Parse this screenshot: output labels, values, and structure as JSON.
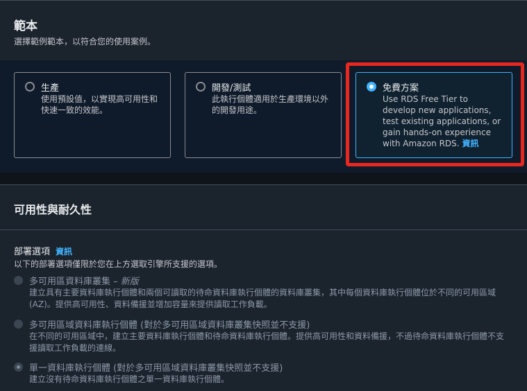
{
  "templates": {
    "title": "範本",
    "description": "選擇範例範本，以符合您的使用案例。",
    "options": [
      {
        "title": "生產",
        "description": "使用預設值，以實現高可用性和快速一致的效能。",
        "selected": false
      },
      {
        "title": "開發/測試",
        "description": "此執行個體適用於生產環境以外的開發用途。",
        "selected": false
      },
      {
        "title": "免費方案",
        "description": "Use RDS Free Tier to develop new applications, test existing applications, or gain hands-on experience with Amazon RDS.",
        "info_link": "資訊",
        "selected": true
      }
    ],
    "highlight_color": "#e8281f",
    "accent_color": "#42b4ff"
  },
  "availability": {
    "title": "可用性與耐久性",
    "deployment_label": "部署選項",
    "deployment_info_link": "資訊",
    "deployment_description": "以下的部署選項僅限於您在上方選取引擎所支援的選項。",
    "options": [
      {
        "title": "多可用區資料庫叢集",
        "title_suffix": "新版",
        "separator": " – ",
        "description": "建立具有主要資料庫執行個體和兩個可讀取的待命資料庫執行個體的資料庫叢集，其中每個資料庫執行個體位於不同的可用區域 (AZ)。提供高可用性、資料備援並增加容量來提供讀取工作負載。",
        "selected": false,
        "disabled": true
      },
      {
        "title": "多可用區域資料庫執行個體 (對於多可用區域資料庫叢集快照並不支援)",
        "description": "在不同的可用區域中，建立主要資料庫執行個體和待命資料庫執行個體。提供高可用性和資料備援，不過待命資料庫執行個體不支援讀取工作負載的連線。",
        "selected": false,
        "disabled": true
      },
      {
        "title": "單一資料庫執行個體 (對於多可用區域資料庫叢集快照並不支援)",
        "description": "建立沒有待命資料庫執行個體之單一資料庫執行個體。",
        "selected": true,
        "disabled": true
      }
    ]
  }
}
